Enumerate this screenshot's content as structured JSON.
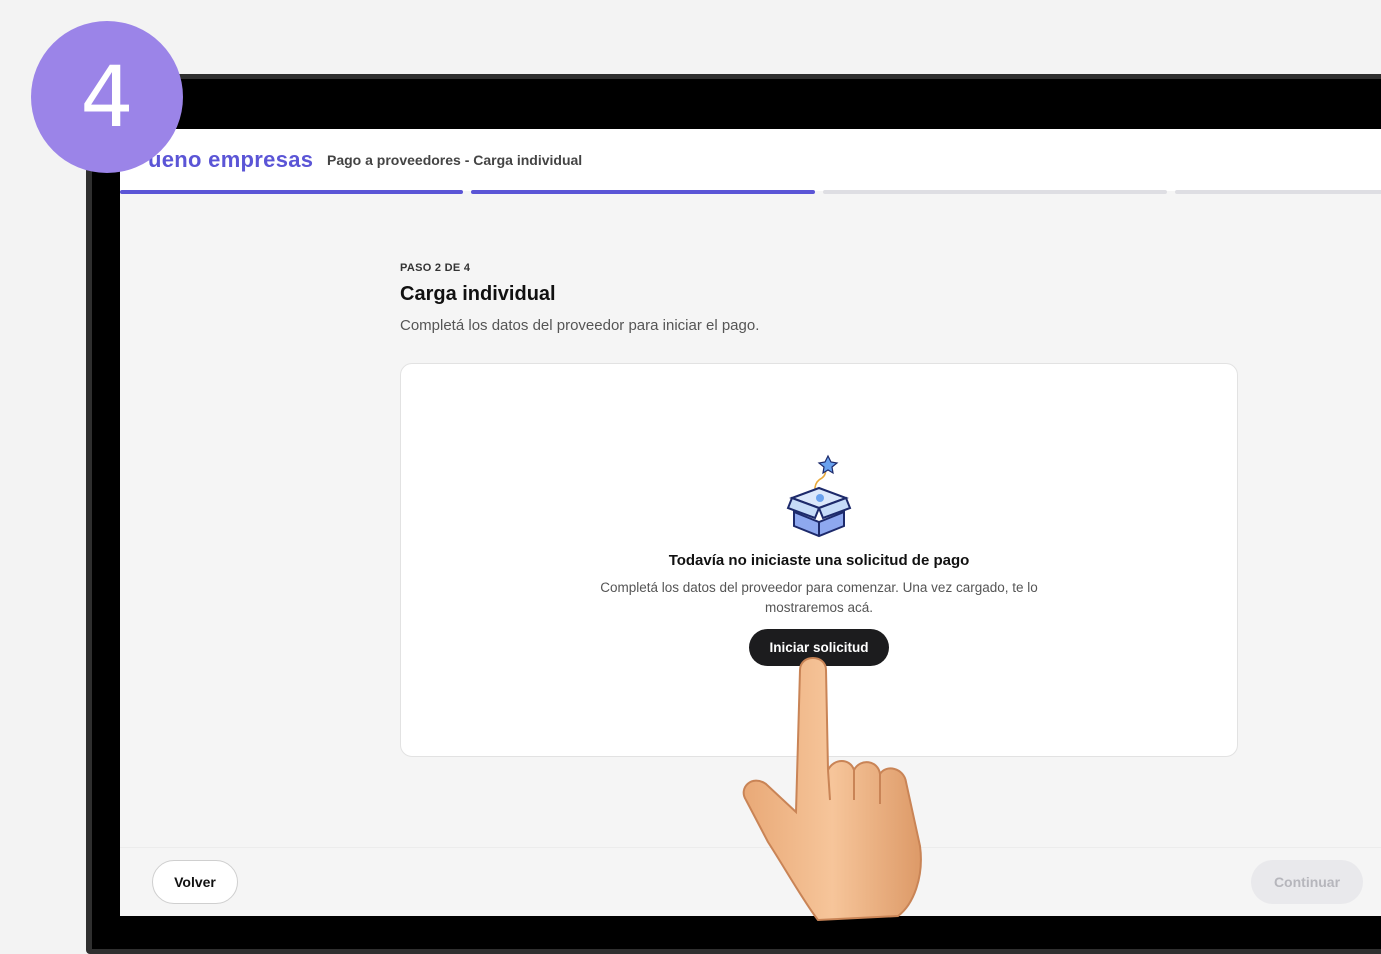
{
  "step_badge": "4",
  "header": {
    "logo": "ueno empresas",
    "breadcrumb": "Pago a proveedores - Carga individual"
  },
  "progress": {
    "current_step": 2,
    "total_steps": 4
  },
  "content": {
    "step_label": "PASO 2 DE 4",
    "title": "Carga individual",
    "subtitle": "Completá los datos del proveedor para iniciar el pago."
  },
  "empty_state": {
    "icon": "open-box-icon",
    "title": "Todavía no iniciaste una solicitud de pago",
    "description": "Completá los datos del proveedor para comenzar. Una vez cargado, te lo mostraremos acá.",
    "button_label": "Iniciar solicitud"
  },
  "footer": {
    "back_label": "Volver",
    "continue_label": "Continuar"
  },
  "colors": {
    "brand": "#5b55d6",
    "badge": "#9b84e8",
    "primary_button": "#1c1c1e"
  }
}
